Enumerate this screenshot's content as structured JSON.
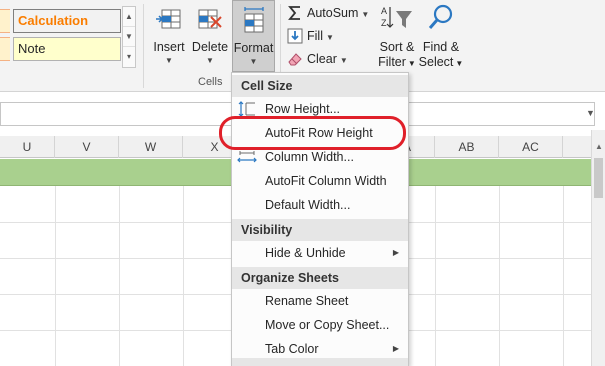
{
  "styles_gallery": {
    "calculation_label": "Calculation",
    "note_label": "Note"
  },
  "cells_group": {
    "insert_label": "Insert",
    "delete_label": "Delete",
    "format_label": "Format",
    "group_label": "Cells"
  },
  "editing_group": {
    "autosum_label": "AutoSum",
    "fill_label": "Fill",
    "clear_label": "Clear",
    "sort_filter_line1": "Sort &",
    "sort_filter_line2": "Filter",
    "find_select_line1": "Find &",
    "find_select_line2": "Select"
  },
  "columns": [
    "U",
    "V",
    "W",
    "X",
    "A",
    "AB",
    "AC"
  ],
  "format_menu": {
    "cell_size_header": "Cell Size",
    "row_height": "Row Height...",
    "autofit_row_height": "AutoFit Row Height",
    "column_width": "Column Width...",
    "autofit_column_width": "AutoFit Column Width",
    "default_width": "Default Width...",
    "visibility_header": "Visibility",
    "hide_unhide": "Hide & Unhide",
    "organize_header": "Organize Sheets",
    "rename_sheet": "Rename Sheet",
    "move_copy_sheet": "Move or Copy Sheet...",
    "tab_color": "Tab Color"
  },
  "colors": {
    "accent_highlight": "#e0202a",
    "header_row_fill": "#a9d08e",
    "calculation_text": "#fa7d00",
    "note_fill": "#ffffcc"
  },
  "icons": {
    "insert": "insert-cells-icon",
    "delete": "delete-cells-icon",
    "format": "format-cells-icon",
    "autosum": "sigma-icon",
    "fill": "fill-down-icon",
    "clear": "eraser-icon",
    "sort_filter": "sort-filter-icon",
    "find_select": "magnifier-icon",
    "row_height": "row-height-icon",
    "column_width": "column-width-icon"
  }
}
